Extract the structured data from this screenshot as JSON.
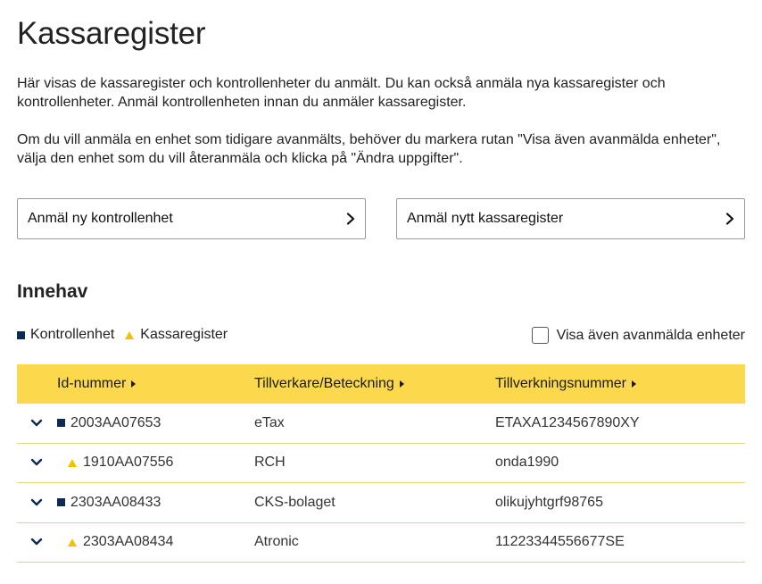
{
  "page": {
    "title": "Kassaregister",
    "intro_1": "Här visas de kassaregister och kontrollenheter du anmält. Du kan också anmäla nya kassaregister och kontrollenheter. Anmäl kontrollenheten innan du anmäler kassaregister.",
    "intro_2": "Om du vill anmäla en enhet som tidigare avanmälts, behöver du markera rutan \"Visa även avanmälda enheter\", välja den enhet som du vill återanmäla och klicka på \"Ändra uppgifter\"."
  },
  "actions": {
    "new_control_unit": "Anmäl ny kontrollenhet",
    "new_register": "Anmäl nytt kassaregister"
  },
  "holdings": {
    "title": "Innehav",
    "legend": {
      "control_unit": "Kontrollenhet",
      "register": "Kassaregister"
    },
    "show_deregistered_label": "Visa även avanmälda enheter",
    "columns": {
      "id": "Id-nummer",
      "manufacturer": "Tillverkare/Beteckning",
      "serial": "Tillverkningsnummer"
    },
    "rows": [
      {
        "type": "control_unit",
        "id": "2003AA07653",
        "manufacturer": "eTax",
        "serial": "ETAXA1234567890XY"
      },
      {
        "type": "register",
        "id": "1910AA07556",
        "manufacturer": "RCH",
        "serial": "onda1990"
      },
      {
        "type": "control_unit",
        "id": "2303AA08433",
        "manufacturer": "CKS-bolaget",
        "serial": "olikujyhtgrf98765"
      },
      {
        "type": "register",
        "id": "2303AA08434",
        "manufacturer": "Atronic",
        "serial": "11223344556677SE"
      }
    ]
  },
  "colors": {
    "header_bg": "#fcd94c",
    "control_unit_marker": "#0b2a55",
    "register_marker": "#f2c200",
    "expand_chevron": "#0b2a55"
  }
}
